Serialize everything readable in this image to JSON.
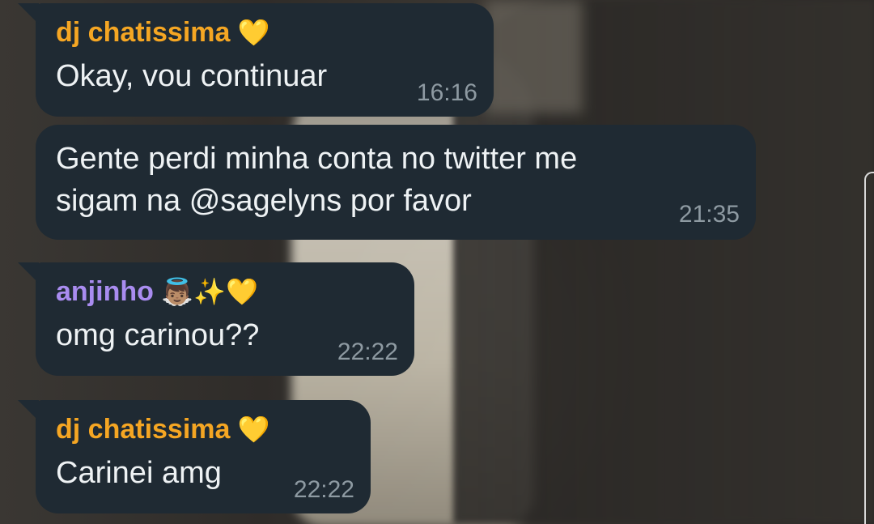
{
  "colors": {
    "bubble_bg": "#1f2a33",
    "text": "#eef2f4",
    "timestamp": "#8e9aa2",
    "sender_dj": "#f5a623",
    "sender_anjinho": "#a98cf0"
  },
  "messages": [
    {
      "sender": "dj chatissima",
      "sender_emoji": "💛",
      "text": "Okay, vou continuar",
      "time": "16:16"
    },
    {
      "text_line1": "Gente perdi minha conta no twitter me",
      "text_line2": "sigam na @sagelyns por favor",
      "time": "21:35"
    },
    {
      "sender": "anjinho",
      "sender_emoji": "👼🏽✨💛",
      "text": "omg carinou??",
      "time": "22:22"
    },
    {
      "sender": "dj chatissima",
      "sender_emoji": "💛",
      "text": "Carinei amg",
      "time": "22:22"
    }
  ]
}
